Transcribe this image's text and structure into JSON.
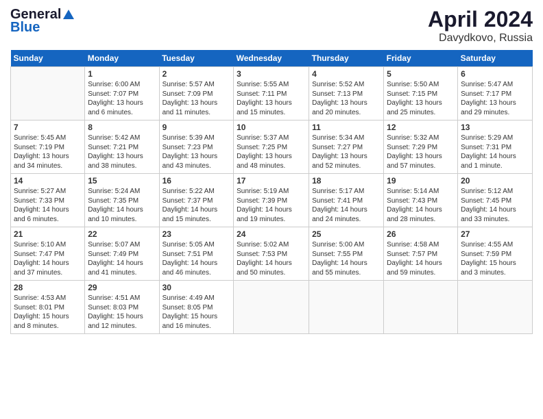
{
  "logo": {
    "general": "General",
    "blue": "Blue"
  },
  "calendar": {
    "title": "April 2024",
    "subtitle": "Davydkovo, Russia"
  },
  "weekdays": [
    "Sunday",
    "Monday",
    "Tuesday",
    "Wednesday",
    "Thursday",
    "Friday",
    "Saturday"
  ],
  "weeks": [
    [
      {
        "day": "",
        "info": ""
      },
      {
        "day": "1",
        "info": "Sunrise: 6:00 AM\nSunset: 7:07 PM\nDaylight: 13 hours\nand 6 minutes."
      },
      {
        "day": "2",
        "info": "Sunrise: 5:57 AM\nSunset: 7:09 PM\nDaylight: 13 hours\nand 11 minutes."
      },
      {
        "day": "3",
        "info": "Sunrise: 5:55 AM\nSunset: 7:11 PM\nDaylight: 13 hours\nand 15 minutes."
      },
      {
        "day": "4",
        "info": "Sunrise: 5:52 AM\nSunset: 7:13 PM\nDaylight: 13 hours\nand 20 minutes."
      },
      {
        "day": "5",
        "info": "Sunrise: 5:50 AM\nSunset: 7:15 PM\nDaylight: 13 hours\nand 25 minutes."
      },
      {
        "day": "6",
        "info": "Sunrise: 5:47 AM\nSunset: 7:17 PM\nDaylight: 13 hours\nand 29 minutes."
      }
    ],
    [
      {
        "day": "7",
        "info": "Sunrise: 5:45 AM\nSunset: 7:19 PM\nDaylight: 13 hours\nand 34 minutes."
      },
      {
        "day": "8",
        "info": "Sunrise: 5:42 AM\nSunset: 7:21 PM\nDaylight: 13 hours\nand 38 minutes."
      },
      {
        "day": "9",
        "info": "Sunrise: 5:39 AM\nSunset: 7:23 PM\nDaylight: 13 hours\nand 43 minutes."
      },
      {
        "day": "10",
        "info": "Sunrise: 5:37 AM\nSunset: 7:25 PM\nDaylight: 13 hours\nand 48 minutes."
      },
      {
        "day": "11",
        "info": "Sunrise: 5:34 AM\nSunset: 7:27 PM\nDaylight: 13 hours\nand 52 minutes."
      },
      {
        "day": "12",
        "info": "Sunrise: 5:32 AM\nSunset: 7:29 PM\nDaylight: 13 hours\nand 57 minutes."
      },
      {
        "day": "13",
        "info": "Sunrise: 5:29 AM\nSunset: 7:31 PM\nDaylight: 14 hours\nand 1 minute."
      }
    ],
    [
      {
        "day": "14",
        "info": "Sunrise: 5:27 AM\nSunset: 7:33 PM\nDaylight: 14 hours\nand 6 minutes."
      },
      {
        "day": "15",
        "info": "Sunrise: 5:24 AM\nSunset: 7:35 PM\nDaylight: 14 hours\nand 10 minutes."
      },
      {
        "day": "16",
        "info": "Sunrise: 5:22 AM\nSunset: 7:37 PM\nDaylight: 14 hours\nand 15 minutes."
      },
      {
        "day": "17",
        "info": "Sunrise: 5:19 AM\nSunset: 7:39 PM\nDaylight: 14 hours\nand 19 minutes."
      },
      {
        "day": "18",
        "info": "Sunrise: 5:17 AM\nSunset: 7:41 PM\nDaylight: 14 hours\nand 24 minutes."
      },
      {
        "day": "19",
        "info": "Sunrise: 5:14 AM\nSunset: 7:43 PM\nDaylight: 14 hours\nand 28 minutes."
      },
      {
        "day": "20",
        "info": "Sunrise: 5:12 AM\nSunset: 7:45 PM\nDaylight: 14 hours\nand 33 minutes."
      }
    ],
    [
      {
        "day": "21",
        "info": "Sunrise: 5:10 AM\nSunset: 7:47 PM\nDaylight: 14 hours\nand 37 minutes."
      },
      {
        "day": "22",
        "info": "Sunrise: 5:07 AM\nSunset: 7:49 PM\nDaylight: 14 hours\nand 41 minutes."
      },
      {
        "day": "23",
        "info": "Sunrise: 5:05 AM\nSunset: 7:51 PM\nDaylight: 14 hours\nand 46 minutes."
      },
      {
        "day": "24",
        "info": "Sunrise: 5:02 AM\nSunset: 7:53 PM\nDaylight: 14 hours\nand 50 minutes."
      },
      {
        "day": "25",
        "info": "Sunrise: 5:00 AM\nSunset: 7:55 PM\nDaylight: 14 hours\nand 55 minutes."
      },
      {
        "day": "26",
        "info": "Sunrise: 4:58 AM\nSunset: 7:57 PM\nDaylight: 14 hours\nand 59 minutes."
      },
      {
        "day": "27",
        "info": "Sunrise: 4:55 AM\nSunset: 7:59 PM\nDaylight: 15 hours\nand 3 minutes."
      }
    ],
    [
      {
        "day": "28",
        "info": "Sunrise: 4:53 AM\nSunset: 8:01 PM\nDaylight: 15 hours\nand 8 minutes."
      },
      {
        "day": "29",
        "info": "Sunrise: 4:51 AM\nSunset: 8:03 PM\nDaylight: 15 hours\nand 12 minutes."
      },
      {
        "day": "30",
        "info": "Sunrise: 4:49 AM\nSunset: 8:05 PM\nDaylight: 15 hours\nand 16 minutes."
      },
      {
        "day": "",
        "info": ""
      },
      {
        "day": "",
        "info": ""
      },
      {
        "day": "",
        "info": ""
      },
      {
        "day": "",
        "info": ""
      }
    ]
  ]
}
